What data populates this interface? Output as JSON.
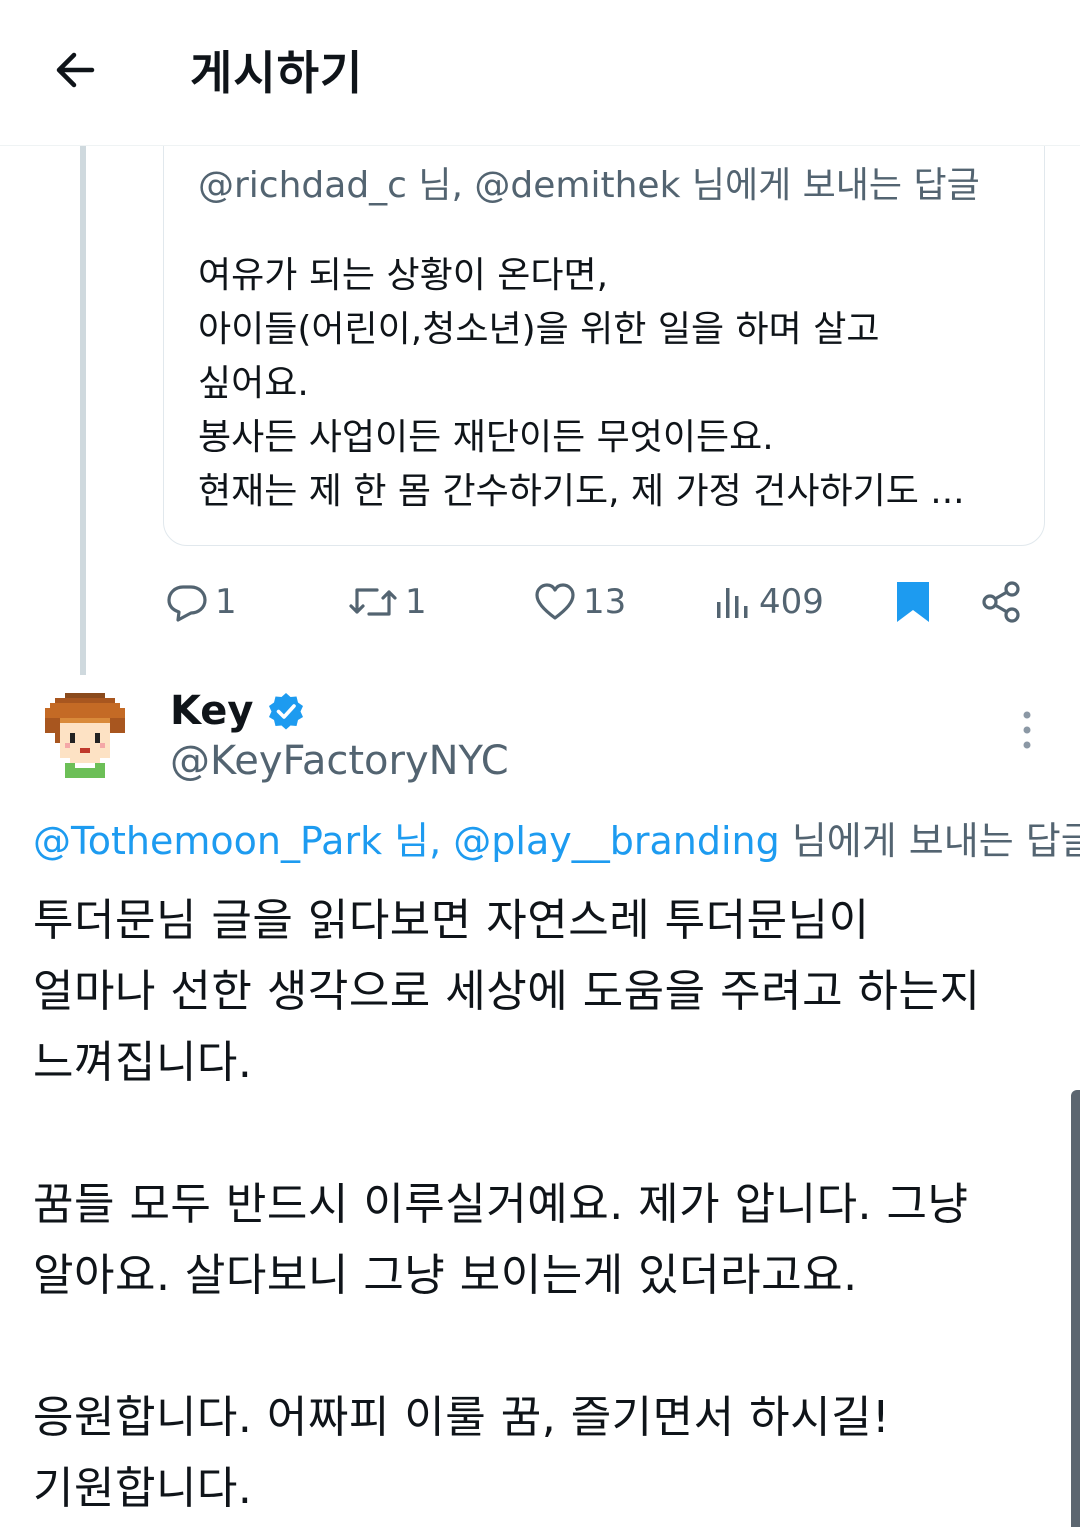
{
  "header": {
    "title": "게시하기"
  },
  "quoted": {
    "replying_handle_1": "@richdad_c",
    "replying_mid": " 님, ",
    "replying_handle_2": "@demithek",
    "replying_suffix": " 님에게 보내는 답글",
    "lines": [
      "여유가 되는 상황이 온다면,",
      "아이들(어린이,청소년)을 위한 일을 하며 살고",
      "싶어요.",
      "봉사든 사업이든 재단이든 무엇이든요.",
      "현재는 제 한 몸 간수하기도, 제 가정 건사하기도 ..."
    ]
  },
  "actions": {
    "replies": "1",
    "reposts": "1",
    "likes": "13",
    "views": "409"
  },
  "author": {
    "name": "Key",
    "handle": "@KeyFactoryNYC"
  },
  "reply": {
    "mention_1": "@Tothemoon_Park",
    "mid": " 님, ",
    "mention_2": "@play__branding",
    "suffix": " 님에게 보내는 답글",
    "paragraph_1": [
      "투더문님 글을 읽다보면 자연스레 투더문님이",
      "얼마나 선한 생각으로 세상에 도움을 주려고 하는지",
      "느껴집니다."
    ],
    "paragraph_2": [
      "꿈들 모두 반드시 이루실거예요. 제가 압니다. 그냥",
      "알아요. 살다보니 그냥 보이는게 있더라고요."
    ],
    "paragraph_3": [
      "응원합니다. 어짜피 이룰 꿈, 즐기면서 하시길!",
      "기원합니다."
    ]
  },
  "colors": {
    "link": "#1d9bf0",
    "secondary_text": "#536471",
    "bookmark_active": "#1d9bf0",
    "verified_badge": "#1d9bf0"
  },
  "icons": {
    "back": "arrow-left-icon",
    "reply": "speech-bubble-icon",
    "repost": "repost-arrows-icon",
    "like": "heart-icon",
    "views": "bar-chart-icon",
    "bookmark": "bookmark-filled-icon",
    "share": "share-icon",
    "more": "vertical-ellipsis-icon"
  }
}
